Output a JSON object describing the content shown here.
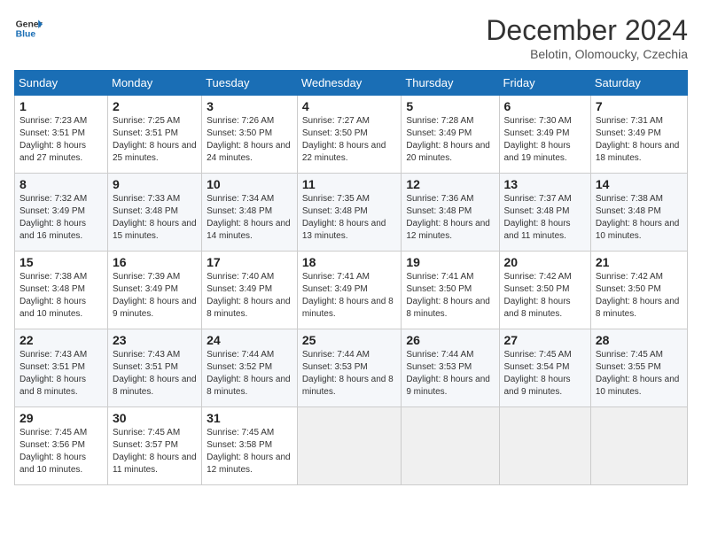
{
  "header": {
    "logo_line1": "General",
    "logo_line2": "Blue",
    "month_title": "December 2024",
    "subtitle": "Belotin, Olomoucky, Czechia"
  },
  "days_of_week": [
    "Sunday",
    "Monday",
    "Tuesday",
    "Wednesday",
    "Thursday",
    "Friday",
    "Saturday"
  ],
  "weeks": [
    [
      {
        "day": "1",
        "sunrise": "7:23 AM",
        "sunset": "3:51 PM",
        "daylight": "8 hours and 27 minutes."
      },
      {
        "day": "2",
        "sunrise": "7:25 AM",
        "sunset": "3:51 PM",
        "daylight": "8 hours and 25 minutes."
      },
      {
        "day": "3",
        "sunrise": "7:26 AM",
        "sunset": "3:50 PM",
        "daylight": "8 hours and 24 minutes."
      },
      {
        "day": "4",
        "sunrise": "7:27 AM",
        "sunset": "3:50 PM",
        "daylight": "8 hours and 22 minutes."
      },
      {
        "day": "5",
        "sunrise": "7:28 AM",
        "sunset": "3:49 PM",
        "daylight": "8 hours and 20 minutes."
      },
      {
        "day": "6",
        "sunrise": "7:30 AM",
        "sunset": "3:49 PM",
        "daylight": "8 hours and 19 minutes."
      },
      {
        "day": "7",
        "sunrise": "7:31 AM",
        "sunset": "3:49 PM",
        "daylight": "8 hours and 18 minutes."
      }
    ],
    [
      {
        "day": "8",
        "sunrise": "7:32 AM",
        "sunset": "3:49 PM",
        "daylight": "8 hours and 16 minutes."
      },
      {
        "day": "9",
        "sunrise": "7:33 AM",
        "sunset": "3:48 PM",
        "daylight": "8 hours and 15 minutes."
      },
      {
        "day": "10",
        "sunrise": "7:34 AM",
        "sunset": "3:48 PM",
        "daylight": "8 hours and 14 minutes."
      },
      {
        "day": "11",
        "sunrise": "7:35 AM",
        "sunset": "3:48 PM",
        "daylight": "8 hours and 13 minutes."
      },
      {
        "day": "12",
        "sunrise": "7:36 AM",
        "sunset": "3:48 PM",
        "daylight": "8 hours and 12 minutes."
      },
      {
        "day": "13",
        "sunrise": "7:37 AM",
        "sunset": "3:48 PM",
        "daylight": "8 hours and 11 minutes."
      },
      {
        "day": "14",
        "sunrise": "7:38 AM",
        "sunset": "3:48 PM",
        "daylight": "8 hours and 10 minutes."
      }
    ],
    [
      {
        "day": "15",
        "sunrise": "7:38 AM",
        "sunset": "3:48 PM",
        "daylight": "8 hours and 10 minutes."
      },
      {
        "day": "16",
        "sunrise": "7:39 AM",
        "sunset": "3:49 PM",
        "daylight": "8 hours and 9 minutes."
      },
      {
        "day": "17",
        "sunrise": "7:40 AM",
        "sunset": "3:49 PM",
        "daylight": "8 hours and 8 minutes."
      },
      {
        "day": "18",
        "sunrise": "7:41 AM",
        "sunset": "3:49 PM",
        "daylight": "8 hours and 8 minutes."
      },
      {
        "day": "19",
        "sunrise": "7:41 AM",
        "sunset": "3:50 PM",
        "daylight": "8 hours and 8 minutes."
      },
      {
        "day": "20",
        "sunrise": "7:42 AM",
        "sunset": "3:50 PM",
        "daylight": "8 hours and 8 minutes."
      },
      {
        "day": "21",
        "sunrise": "7:42 AM",
        "sunset": "3:50 PM",
        "daylight": "8 hours and 8 minutes."
      }
    ],
    [
      {
        "day": "22",
        "sunrise": "7:43 AM",
        "sunset": "3:51 PM",
        "daylight": "8 hours and 8 minutes."
      },
      {
        "day": "23",
        "sunrise": "7:43 AM",
        "sunset": "3:51 PM",
        "daylight": "8 hours and 8 minutes."
      },
      {
        "day": "24",
        "sunrise": "7:44 AM",
        "sunset": "3:52 PM",
        "daylight": "8 hours and 8 minutes."
      },
      {
        "day": "25",
        "sunrise": "7:44 AM",
        "sunset": "3:53 PM",
        "daylight": "8 hours and 8 minutes."
      },
      {
        "day": "26",
        "sunrise": "7:44 AM",
        "sunset": "3:53 PM",
        "daylight": "8 hours and 9 minutes."
      },
      {
        "day": "27",
        "sunrise": "7:45 AM",
        "sunset": "3:54 PM",
        "daylight": "8 hours and 9 minutes."
      },
      {
        "day": "28",
        "sunrise": "7:45 AM",
        "sunset": "3:55 PM",
        "daylight": "8 hours and 10 minutes."
      }
    ],
    [
      {
        "day": "29",
        "sunrise": "7:45 AM",
        "sunset": "3:56 PM",
        "daylight": "8 hours and 10 minutes."
      },
      {
        "day": "30",
        "sunrise": "7:45 AM",
        "sunset": "3:57 PM",
        "daylight": "8 hours and 11 minutes."
      },
      {
        "day": "31",
        "sunrise": "7:45 AM",
        "sunset": "3:58 PM",
        "daylight": "8 hours and 12 minutes."
      },
      null,
      null,
      null,
      null
    ]
  ],
  "labels": {
    "sunrise": "Sunrise:",
    "sunset": "Sunset:",
    "daylight": "Daylight:"
  }
}
